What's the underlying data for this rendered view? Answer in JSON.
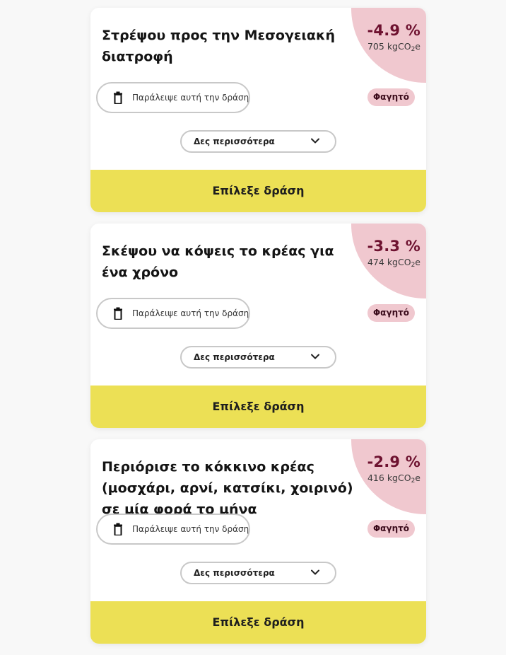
{
  "actions": [
    {
      "title": "Στρέψου προς την Μεσογειακή διατροφή",
      "impact_percent": "-4.9 %",
      "impact_amount": "705 kgCO",
      "impact_unit_sub": "2",
      "impact_unit_suffix": "e",
      "skip_label": "Παράλειψε αυτή την δράση",
      "category": "Φαγητό",
      "more_label": "Δες περισσότερα",
      "select_label": "Επίλεξε δράση"
    },
    {
      "title": "Σκέψου να κόψεις το κρέας για ένα χρόνο",
      "impact_percent": "-3.3 %",
      "impact_amount": "474 kgCO",
      "impact_unit_sub": "2",
      "impact_unit_suffix": "e",
      "skip_label": "Παράλειψε αυτή την δράση",
      "category": "Φαγητό",
      "more_label": "Δες περισσότερα",
      "select_label": "Επίλεξε δράση"
    },
    {
      "title": "Περιόρισε το κόκκινο κρέας (μοσχάρι, αρνί, κατσίκι, χοιρινό) σε μία φορά το μήνα",
      "impact_percent": "-2.9 %",
      "impact_amount": "416 kgCO",
      "impact_unit_sub": "2",
      "impact_unit_suffix": "e",
      "skip_label": "Παράλειψε αυτή την δράση",
      "category": "Φαγητό",
      "more_label": "Δες περισσότερα",
      "select_label": "Επίλεξε δράση"
    }
  ],
  "icons": {
    "skip": "trash-icon",
    "more": "chevron-down-icon"
  },
  "colors": {
    "impact_bg": "#f0c8cf",
    "impact_text": "#6e1230",
    "select_button": "#ece055",
    "page_bg": "#f8f8f8"
  }
}
